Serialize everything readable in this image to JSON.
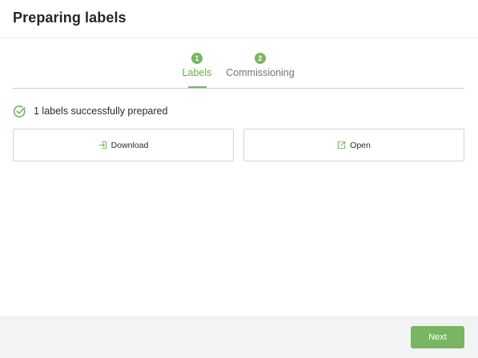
{
  "dialog": {
    "title": "Preparing labels"
  },
  "stepper": {
    "steps": [
      {
        "number": "1",
        "label": "Labels",
        "active": true
      },
      {
        "number": "2",
        "label": "Commissioning",
        "active": false
      }
    ]
  },
  "status": {
    "message": "1 labels successfully prepared",
    "icon": "check-circle-icon"
  },
  "actions": {
    "download": {
      "label": "Download",
      "icon": "download-icon"
    },
    "open": {
      "label": "Open",
      "icon": "external-link-icon"
    }
  },
  "footer": {
    "next_label": "Next"
  },
  "colors": {
    "accent": "#7ab661",
    "footer_bg": "#f2f3f5"
  }
}
